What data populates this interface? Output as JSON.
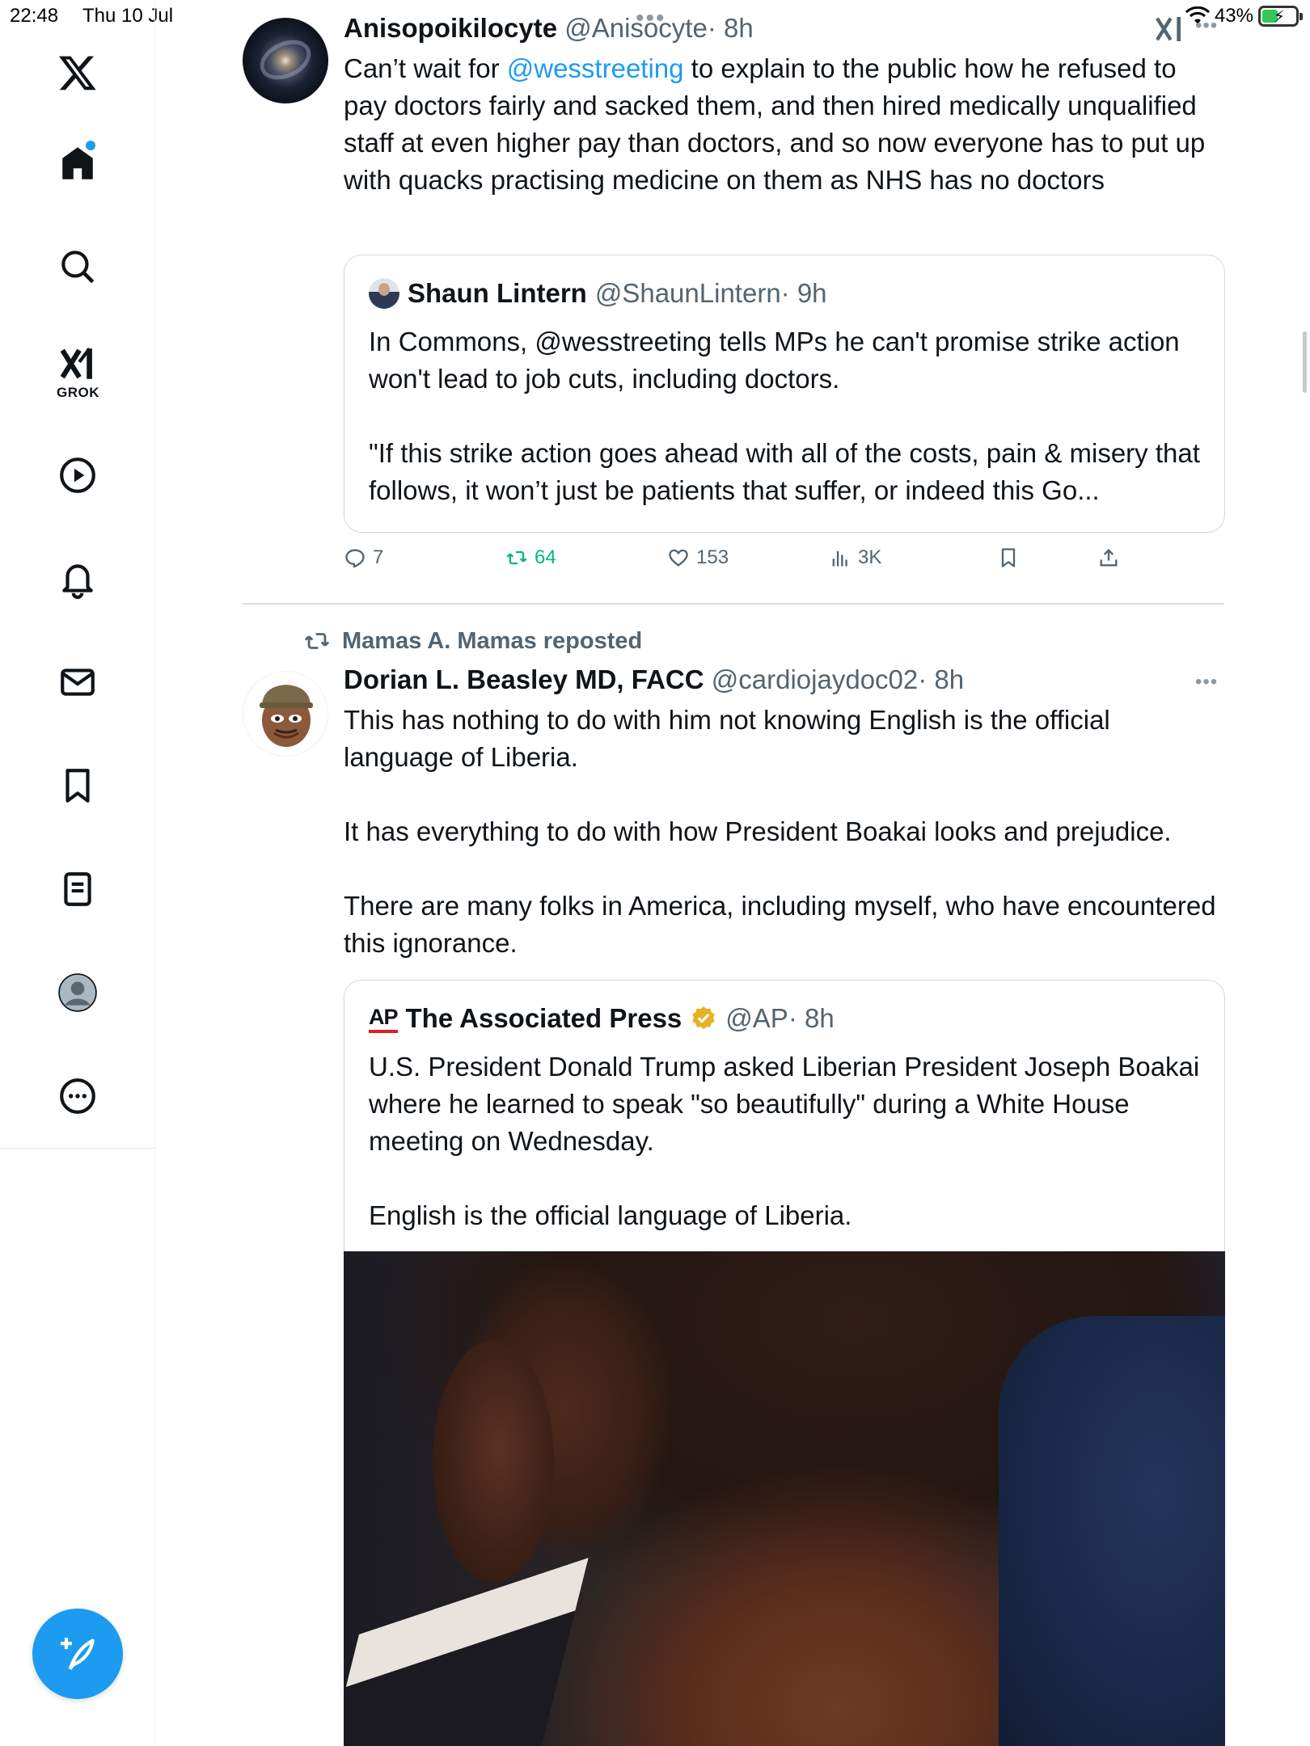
{
  "status_bar": {
    "time": "22:48",
    "date": "Thu 10 Jul",
    "battery_percent": "43%",
    "battery_level": 0.43
  },
  "sidebar": {
    "logo_icon": "x-logo-icon",
    "items": [
      {
        "name": "home",
        "icon": "home-icon",
        "active": true,
        "unread": true
      },
      {
        "name": "explore",
        "icon": "search-icon"
      },
      {
        "name": "grok",
        "icon": "grok-icon",
        "label": "GROK"
      },
      {
        "name": "video",
        "icon": "play-icon"
      },
      {
        "name": "notifications",
        "icon": "bell-icon"
      },
      {
        "name": "messages",
        "icon": "envelope-icon"
      },
      {
        "name": "bookmarks",
        "icon": "bookmark-icon"
      },
      {
        "name": "lists",
        "icon": "list-icon"
      },
      {
        "name": "profile",
        "icon": "avatar-icon"
      },
      {
        "name": "more",
        "icon": "more-circle-icon"
      }
    ],
    "compose_icon": "compose-icon"
  },
  "colors": {
    "accent": "#1d9bf0",
    "text_primary": "#0f1419",
    "text_secondary": "#536471",
    "retweet_green": "#00ba7c",
    "ap_red": "#e31b23"
  },
  "posts": [
    {
      "author_name": "Anisopoikilocyte",
      "handle": "@Anisocyte",
      "time": "· 8h",
      "text_mention": "@wesstreeting",
      "text_prefix": "Can’t wait for ",
      "text_rest": " to explain to the public how he refused to pay doctors fairly and sacked them, and then hired medically unqualified staff at even higher pay than doctors, and so now everyone has to put up with quacks practising medicine on them as NHS has no doctors",
      "quote": {
        "author_name": "Shaun Lintern",
        "handle": "@ShaunLintern",
        "time": "· 9h",
        "text": "In Commons, @wesstreeting tells MPs he can't promise strike action won't lead to job cuts, including doctors.\n\n\"If this strike action goes ahead with all of the costs, pain & misery that follows, it won’t just be patients that suffer, or indeed this Go..."
      },
      "actions": {
        "replies": "7",
        "reposts": "64",
        "likes": "153",
        "views": "3K",
        "reply_icon": "reply-icon",
        "repost_icon": "repost-icon",
        "like_icon": "heart-icon",
        "views_icon": "views-icon",
        "bookmark_icon": "bookmark-icon",
        "share_icon": "share-icon"
      }
    },
    {
      "reposted_by": "Mamas A. Mamas reposted",
      "author_name": "Dorian L. Beasley MD, FACC",
      "handle": "@cardiojaydoc02",
      "time": "· 8h",
      "text": "This has nothing to do with him not knowing English is the official language of Liberia.\n\nIt has everything to do with how President Boakai looks and prejudice.\n\nThere are many folks in America, including myself, who have encountered this ignorance.",
      "quote": {
        "logo": "AP",
        "author_name": "The Associated Press",
        "verified_icon": "verified-gold-icon",
        "handle": "@AP",
        "time": "· 8h",
        "text": "U.S. President Donald Trump asked Liberian President Joseph Boakai where he learned to speak \"so beautifully\" during a White House meeting on Wednesday.\n\nEnglish is the official language of Liberia."
      }
    }
  ]
}
